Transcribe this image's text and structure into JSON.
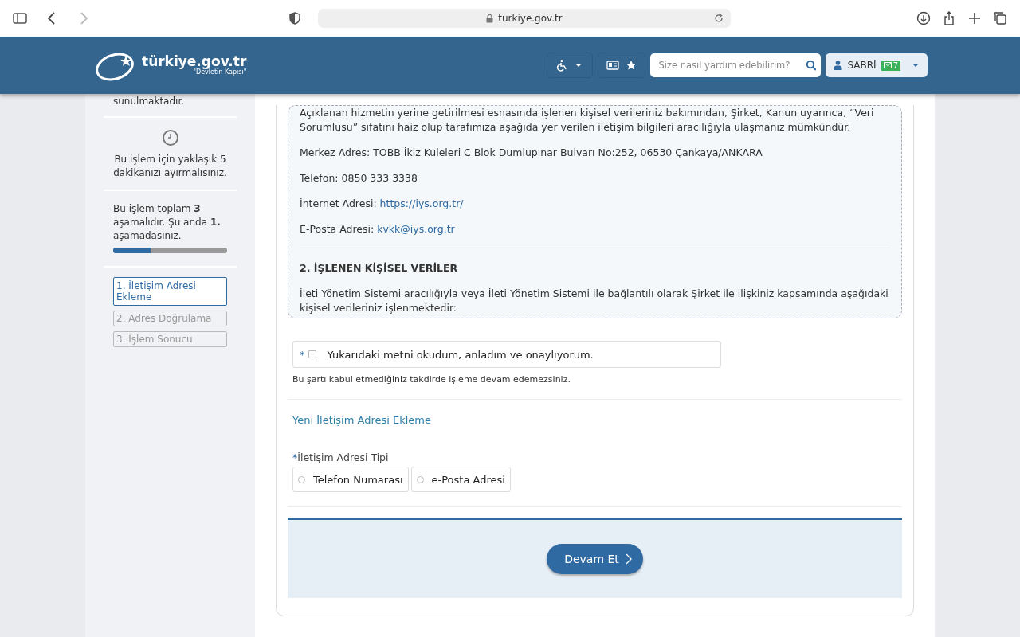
{
  "browser": {
    "url": "turkiye.gov.tr"
  },
  "header": {
    "logo_text": "türkiye.gov.tr",
    "logo_tagline": "\"Devletin Kapısı\"",
    "search": {
      "placeholder": "Size nasıl yardım edebilirim?"
    },
    "user": {
      "name": "SABRİ",
      "messages": "7"
    }
  },
  "sidebar": {
    "intro_tail": "sunulmaktadır.",
    "duration": "Bu işlem için yaklaşık 5 dakikanızı ayırmalısınız.",
    "progress_text": "Bu işlem toplam **3** aşamalıdır. Şu anda **1.** aşamadasınız.",
    "progress": {
      "level": 0.33
    },
    "steps": [
      {
        "label": "1. İletişim Adresi Ekleme",
        "selected": true
      },
      {
        "label": "2. Adres Doğrulama",
        "selected": false
      },
      {
        "label": "3. İşlem Sonucu",
        "selected": false
      }
    ]
  },
  "notice": {
    "paragraphs": [
      {
        "text": "Açıklanan hizmetin yerine getirilmesi esnasında işlenen kişisel verileriniz bakımından, Şirket, Kanun uyarınca, “Veri Sorumlusu” sıfatını haiz olup tarafımıza aşağıda yer verilen iletişim bilgileri aracılığıyla ulaşmanız mümkündür."
      },
      {
        "text": "Merkez Adres: TOBB İkiz Kuleleri C Blok Dumlupınar Bulvarı No:252, 06530 Çankaya/ANKARA"
      },
      {
        "text": "Telefon: 0850 333 3338"
      },
      {
        "text": "İnternet Adresi: ",
        "link": "https://iys.org.tr/"
      },
      {
        "text": "E-Posta Adresi: ",
        "link": "kvkk@iys.org.tr"
      }
    ],
    "section_title": "2. İŞLENEN KİŞİSEL VERİLER",
    "section_text": "İleti Yönetim Sistemi aracılığıyla veya İleti Yönetim Sistemi ile bağlantılı olarak Şirket ile ilişkiniz kapsamında aşağıdaki kişisel verileriniz işlenmektedir:"
  },
  "consent": {
    "required_mark": "*",
    "label": "Yukarıdaki metni okudum, anladım ve onaylıyorum.",
    "checked": false,
    "hint": "Bu şartı kabul etmediğiniz takdirde işleme devam edemezsiniz."
  },
  "form": {
    "title": "Yeni İletişim Adresi Ekleme",
    "required_mark": "*",
    "field_label": "İletişim Adresi Tipi",
    "options": [
      {
        "label": "Telefon Numarası",
        "selected": false
      },
      {
        "label": "e-Posta Adresi",
        "selected": false
      }
    ]
  },
  "submit": {
    "label": "Devam Et"
  }
}
